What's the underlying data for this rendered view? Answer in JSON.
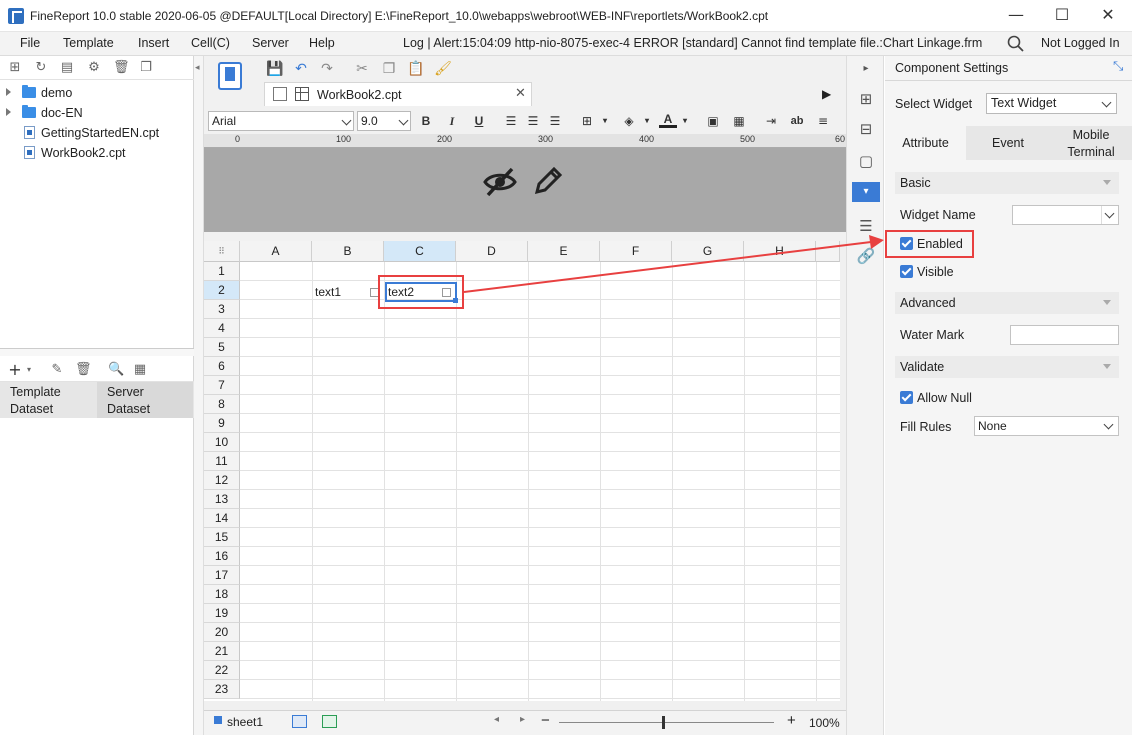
{
  "titlebar": {
    "title": "FineReport 10.0 stable 2020-06-05 @DEFAULT[Local Directory]    E:\\FineReport_10.0\\webapps\\webroot\\WEB-INF\\reportlets/WorkBook2.cpt",
    "minimize": "—",
    "maximize": "☐",
    "close": "✕"
  },
  "menubar": {
    "items": [
      "File",
      "Template",
      "Insert",
      "Cell(C)",
      "Server",
      "Help"
    ],
    "alert": "Log | Alert:15:04:09 http-nio-8075-exec-4 ERROR [standard] Cannot find template file.:Chart Linkage.frm",
    "login": "Not Logged In"
  },
  "tree": {
    "items": [
      {
        "label": "demo",
        "type": "folder"
      },
      {
        "label": "doc-EN",
        "type": "folder"
      },
      {
        "label": "GettingStartedEN.cpt",
        "type": "file"
      },
      {
        "label": "WorkBook2.cpt",
        "type": "file"
      }
    ]
  },
  "dataset": {
    "tabs": [
      {
        "label": "Template\nDataset"
      },
      {
        "label": "Server\nDataset"
      }
    ]
  },
  "editor": {
    "tab_label": "WorkBook2.cpt",
    "tab_close": "✕",
    "font_name": "Arial",
    "font_size": "9.0",
    "bold": "B",
    "italic": "I",
    "underline": "U",
    "ruler_marks": [
      "0",
      "100",
      "200",
      "300",
      "400",
      "500",
      "60"
    ],
    "columns": [
      "A",
      "B",
      "C",
      "D",
      "E",
      "F",
      "G",
      "H"
    ],
    "rows": [
      "1",
      "2",
      "3",
      "4",
      "5",
      "6",
      "7",
      "8",
      "9",
      "10",
      "11",
      "12",
      "13",
      "14",
      "15",
      "16",
      "17",
      "18",
      "19",
      "20",
      "21",
      "22",
      "23"
    ],
    "cells": {
      "B2": "text1",
      "C2": "text2"
    },
    "sheet_tab": "sheet1",
    "zoom": "100%",
    "zoom_minus": "−",
    "zoom_plus": "+"
  },
  "component_settings": {
    "title": "Component Settings",
    "select_widget_label": "Select Widget",
    "select_widget_value": "Text Widget",
    "tabs": [
      "Attribute",
      "Event",
      "Mobile\nTerminal"
    ],
    "basic_label": "Basic",
    "widget_name_label": "Widget Name",
    "widget_name_value": "",
    "enabled_label": "Enabled",
    "visible_label": "Visible",
    "advanced_label": "Advanced",
    "water_mark_label": "Water Mark",
    "water_mark_value": "",
    "validate_label": "Validate",
    "allow_null_label": "Allow Null",
    "fill_rules_label": "Fill Rules",
    "fill_rules_value": "None"
  },
  "colors": {
    "accent": "#3a7bd5",
    "highlight": "#e84040",
    "selected_cell": "#3a7bd5"
  }
}
